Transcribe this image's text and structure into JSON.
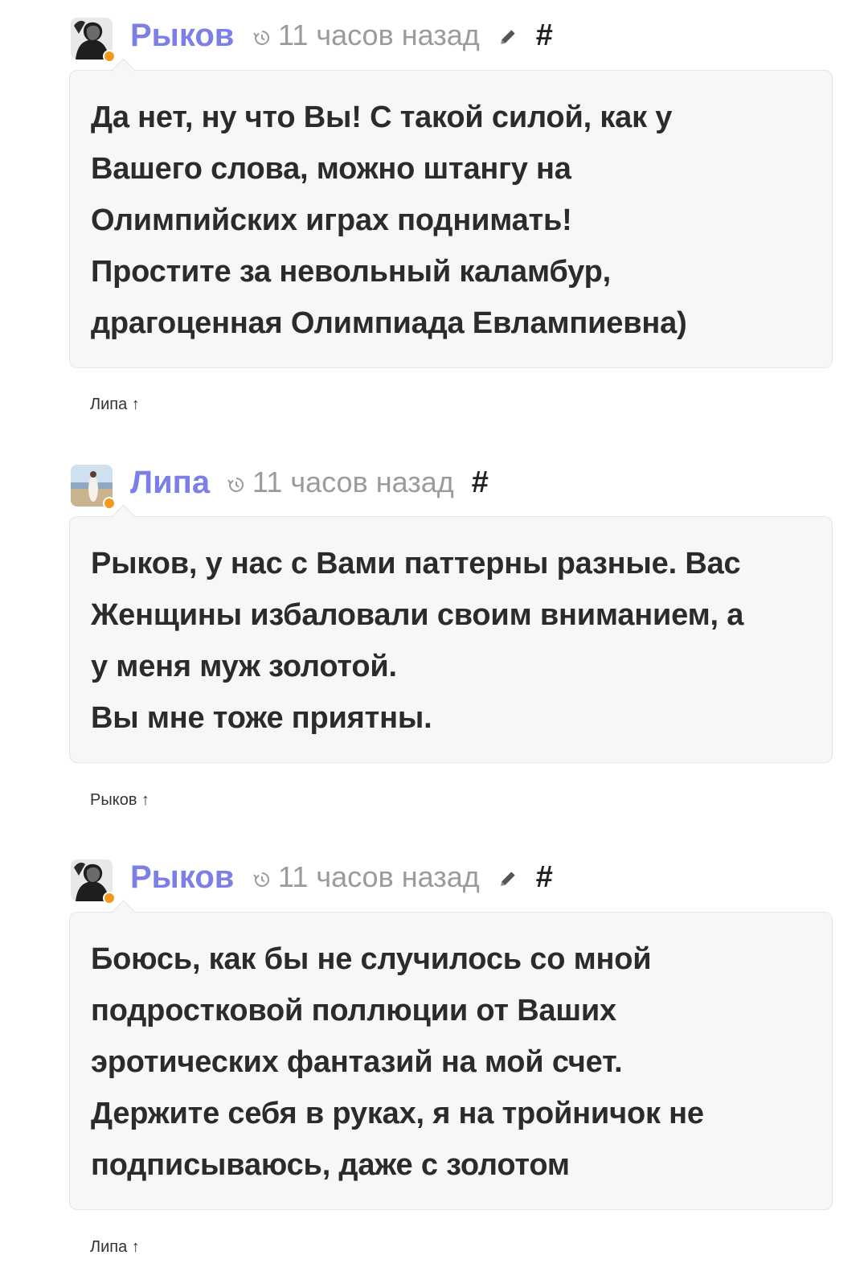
{
  "comments": [
    {
      "author": "Рыков",
      "time": "11 часов назад",
      "has_edit": true,
      "hash": "#",
      "text": "Да нет, ну что Вы! С такой силой, как у\nВашего слова, можно штангу на\nОлимпийских играх поднимать!\nПростите за невольный каламбур,\nдрагоценная Олимпиада Евлампиевна)",
      "reply_to": "Липа ↑"
    },
    {
      "author": "Липа",
      "time": "11 часов назад",
      "has_edit": false,
      "hash": "#",
      "text": "Рыков, у нас с Вами паттерны разные. Вас\nЖенщины избаловали своим вниманием, а\nу меня муж золотой.\nВы мне тоже приятны.",
      "reply_to": "Рыков ↑"
    },
    {
      "author": "Рыков",
      "time": "11 часов назад",
      "has_edit": true,
      "hash": "#",
      "text": "Боюсь, как бы не случилось со мной\nподростковой поллюции от Ваших\nэротических фантазий на мой счет.\nДержите себя в руках, я на тройничок не\nподписываюсь, даже с золотом",
      "reply_to": "Липа ↑"
    }
  ],
  "icons": {
    "history": "history-icon",
    "edit": "pencil-icon",
    "online": "online-dot"
  },
  "colors": {
    "author": "#7b7fe6",
    "meta": "#9b9b9b",
    "bubble_bg": "#f6f7f9",
    "online_dot": "#f29a1d"
  }
}
